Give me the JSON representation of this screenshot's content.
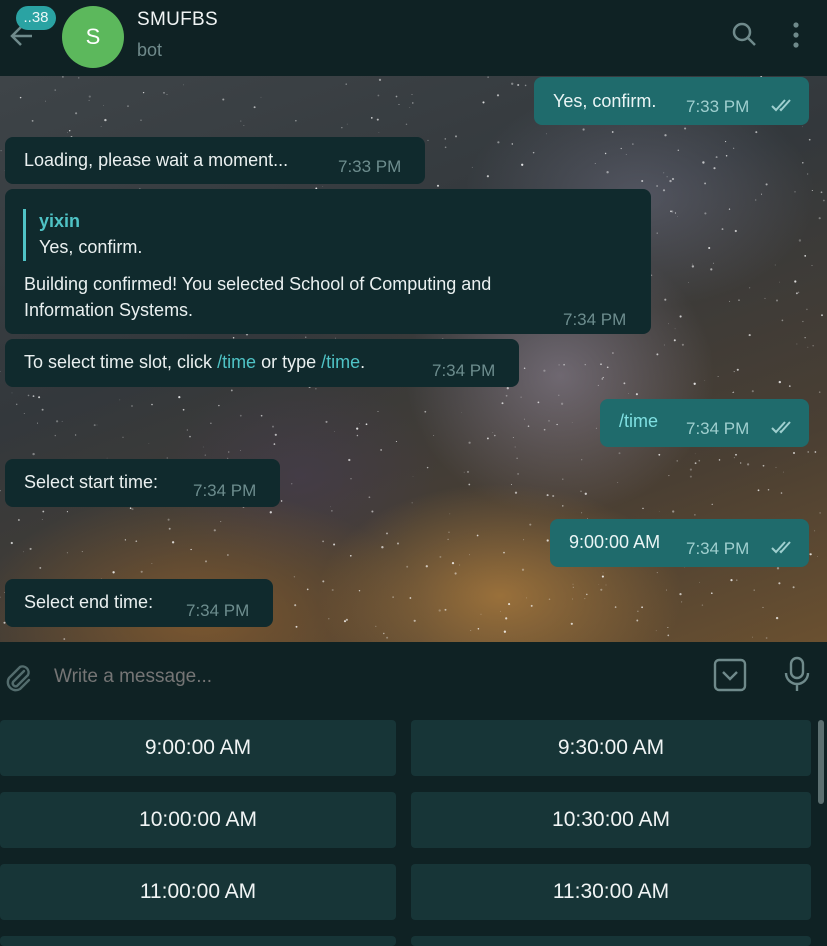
{
  "header": {
    "unread_count": "..38",
    "avatar_letter": "S",
    "title": "SMUFBS",
    "subtitle": "bot",
    "icons": [
      "back-arrow-icon",
      "search-icon",
      "more-vertical-icon"
    ]
  },
  "messages": [
    {
      "dir": "out",
      "text": "Yes, confirm.",
      "time": "7:33 PM"
    },
    {
      "dir": "in",
      "text": "Loading, please wait a moment...",
      "time": "7:33 PM"
    },
    {
      "dir": "in",
      "reply_author": "yixin",
      "reply_text": "Yes, confirm.",
      "text_line1": "Building confirmed! You selected School of Computing and",
      "text_line2": "Information Systems.",
      "time": "7:34 PM"
    },
    {
      "dir": "in",
      "text_before": "To select time slot, click ",
      "link1": "/time",
      "text_mid": " or type ",
      "link2": "/time",
      "text_after": ".",
      "time": "7:34 PM"
    },
    {
      "dir": "out",
      "text": "/time",
      "time": "7:34 PM"
    },
    {
      "dir": "in",
      "text": "Select start time:",
      "time": "7:34 PM"
    },
    {
      "dir": "out",
      "text": "9:00:00 AM",
      "time": "7:34 PM"
    },
    {
      "dir": "in",
      "text": "Select end time:",
      "time": "7:34 PM"
    }
  ],
  "composer": {
    "placeholder": "Write a message..."
  },
  "keyboard": {
    "buttons": [
      "9:00:00 AM",
      "9:30:00 AM",
      "10:00:00 AM",
      "10:30:00 AM",
      "11:00:00 AM",
      "11:30:00 AM"
    ]
  },
  "colors": {
    "header_bg": "#0f2224",
    "incoming_bubble": "#102a2d",
    "outgoing_bubble": "#1f6b6c",
    "link": "#4fc3c6",
    "avatar": "#5cb85c",
    "badge": "#2aa3a3"
  }
}
